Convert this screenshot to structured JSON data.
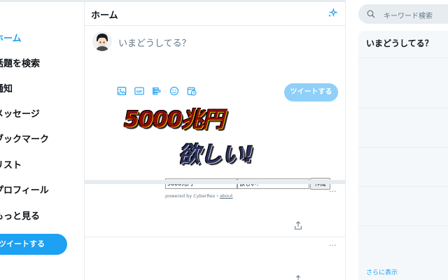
{
  "nav": {
    "items": [
      {
        "label": "ホーム",
        "active": true
      },
      {
        "label": "話題を検索"
      },
      {
        "label": "通知"
      },
      {
        "label": "メッセージ"
      },
      {
        "label": "ブックマーク"
      },
      {
        "label": "リスト"
      },
      {
        "label": "プロフィール"
      },
      {
        "label": "もっと見る"
      }
    ],
    "tweet_button": "ツイートする"
  },
  "main": {
    "title": "ホーム",
    "compose": {
      "placeholder": "いまどうしてる？",
      "tweet_button": "ツイートする",
      "toolbar_icons": [
        "image-icon",
        "gif-icon",
        "poll-icon",
        "emoji-icon",
        "schedule-icon"
      ]
    },
    "generator": {
      "banner_line1": "5000兆円",
      "banner_line2": "欲しい!",
      "input_top": "5000兆円",
      "input_bottom": "欲しい！",
      "create_button": "作成",
      "powered_by": "powered by CyberRex・",
      "about_link": "about"
    },
    "feed_more": "···"
  },
  "right": {
    "search_placeholder": "キーワード検索",
    "trends_title": "いまどうしてる？",
    "show_more": "さらに表示"
  },
  "colors": {
    "accent": "#1da1f2",
    "accent_disabled": "#8ed0f9",
    "border": "#e6ecf0",
    "muted": "#657786"
  }
}
